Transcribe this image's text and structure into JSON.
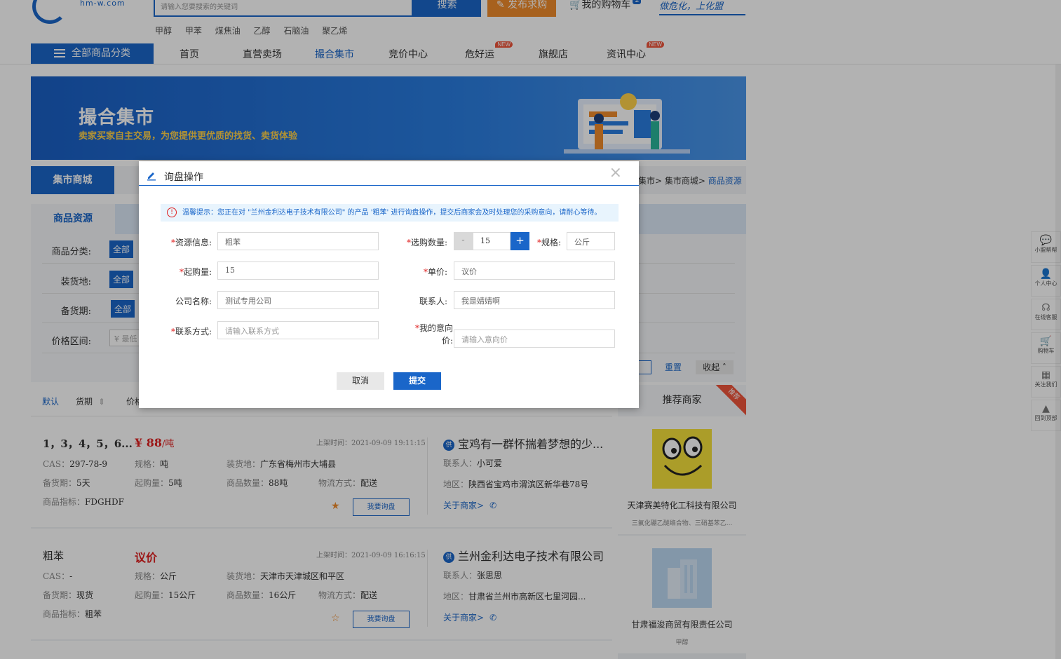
{
  "header": {
    "logo_text": "hm-w.com",
    "search_placeholder": "请输入您要搜索的关键词",
    "search_button": "搜索",
    "post_button": "发布求购",
    "cart_label": "我的购物车",
    "cart_count": "2",
    "slogan": "做危化，上化盟",
    "hot_words": [
      "甲醇",
      "甲苯",
      "煤焦油",
      "乙醇",
      "石脑油",
      "聚乙烯"
    ]
  },
  "nav": {
    "all_categories": "全部商品分类",
    "items": [
      {
        "label": "首页"
      },
      {
        "label": "直营卖场"
      },
      {
        "label": "撮合集市"
      },
      {
        "label": "竞价中心"
      },
      {
        "label": "危好运",
        "badge": "NEW"
      },
      {
        "label": "旗舰店"
      },
      {
        "label": "资讯中心",
        "badge": "NEW"
      }
    ]
  },
  "banner": {
    "title": "撮合集市",
    "subtitle": "卖家买家自主交易，为您提供更优质的找货、卖货体验"
  },
  "subnav": {
    "tab": "集市商城",
    "breadcrumb_prefix": "集市> 集市商城> ",
    "breadcrumb_current": "商品资源"
  },
  "filters": {
    "tab": "商品资源",
    "rows": [
      {
        "label": "商品分类:",
        "tag": "全部"
      },
      {
        "label": "装货地:",
        "tag": "全部"
      },
      {
        "label": "备货期:",
        "tag": "全部"
      },
      {
        "label": "价格区间:",
        "placeholder": "¥ 最低"
      }
    ],
    "reset": "重置",
    "collapse": "收起"
  },
  "sort": {
    "default": "默认",
    "delivery": "货期",
    "price": "价格"
  },
  "listings": [
    {
      "title": "1，3，4，5，6...",
      "price": "¥ 88",
      "unit": "/吨",
      "time": "上架时间：2021-09-09 19:11:15",
      "cas": "297-78-9",
      "spec": "吨",
      "loading": "广东省梅州市大埔县",
      "prep": "5天",
      "min_qty": "5吨",
      "quantity": "88吨",
      "logistics": "配送",
      "index": "FDGHDF",
      "ask": "我要询盘",
      "company": "宝鸡有一群怀揣着梦想的少...",
      "contact": "小可爱",
      "region": "陕西省宝鸡市渭滨区新华巷78号",
      "about": "关于商家>",
      "starred": true
    },
    {
      "title": "粗苯",
      "price": "议价",
      "unit": "",
      "time": "上架时间：2021-09-09 16:16:15",
      "cas": "-",
      "spec": "公斤",
      "loading": "天津市天津城区和平区",
      "prep": "现货",
      "min_qty": "15公斤",
      "quantity": "16公斤",
      "logistics": "配送",
      "index": "粗苯",
      "ask": "我要询盘",
      "company": "兰州金利达电子技术有限公司",
      "contact": "张思思",
      "region": "甘肃省兰州市高新区七里河园...",
      "about": "关于商家>",
      "starred": false
    }
  ],
  "labels": {
    "cas": "CAS：",
    "spec": "规格：",
    "loading": "装货地：",
    "prep": "备货期：",
    "min_qty": "起购量：",
    "quantity": "商品数量：",
    "logistics": "物流方式：",
    "index": "商品指标：",
    "contact": "联系人：",
    "region": "地区："
  },
  "recommend": {
    "title": "推荐商家",
    "corner": "推荐",
    "merchants": [
      {
        "name": "天津赛美特化工科技有限公司",
        "desc": "三氟化硼乙醚络合物、三硝基苯乙..."
      },
      {
        "name": "甘肃福浚商贸有限责任公司",
        "desc": "甲醇"
      }
    ]
  },
  "sidebar": [
    {
      "label": "小盟帮帮",
      "icon": "chat-icon"
    },
    {
      "label": "个人中心",
      "icon": "user-icon"
    },
    {
      "label": "在线客服",
      "icon": "headset-icon"
    },
    {
      "label": "购物车",
      "icon": "cart-icon"
    },
    {
      "label": "关注我们",
      "icon": "qrcode-icon"
    },
    {
      "label": "回到顶部",
      "icon": "arrow-up-icon"
    }
  ],
  "modal": {
    "title": "询盘操作",
    "notice": "温馨提示：您正在对 \"兰州金利达电子技术有限公司\" 的产品 '粗苯' 进行询盘操作，提交后商家会及时处理您的采购意向，请耐心等待。",
    "fields": {
      "resource_label": "资源信息:",
      "resource_value": "粗苯",
      "qty_label": "选购数量:",
      "qty_value": "15",
      "spec_label": "规格:",
      "spec_value": "公斤",
      "min_label": "起购量:",
      "min_value": "15",
      "unit_price_label": "单价:",
      "unit_price_value": "议价",
      "company_label": "公司名称:",
      "company_value": "测试专用公司",
      "contact_label": "联系人:",
      "contact_value": "我是婧婧啊",
      "phone_label": "联系方式:",
      "phone_placeholder": "请输入联系方式",
      "intent_label_1": "我的意向",
      "intent_label_2": "价:",
      "intent_placeholder": "请输入意向价"
    },
    "cancel": "取消",
    "submit": "提交"
  },
  "colors": {
    "primary": "#1a66c9",
    "accent": "#f08b2c",
    "price": "#e02020"
  }
}
